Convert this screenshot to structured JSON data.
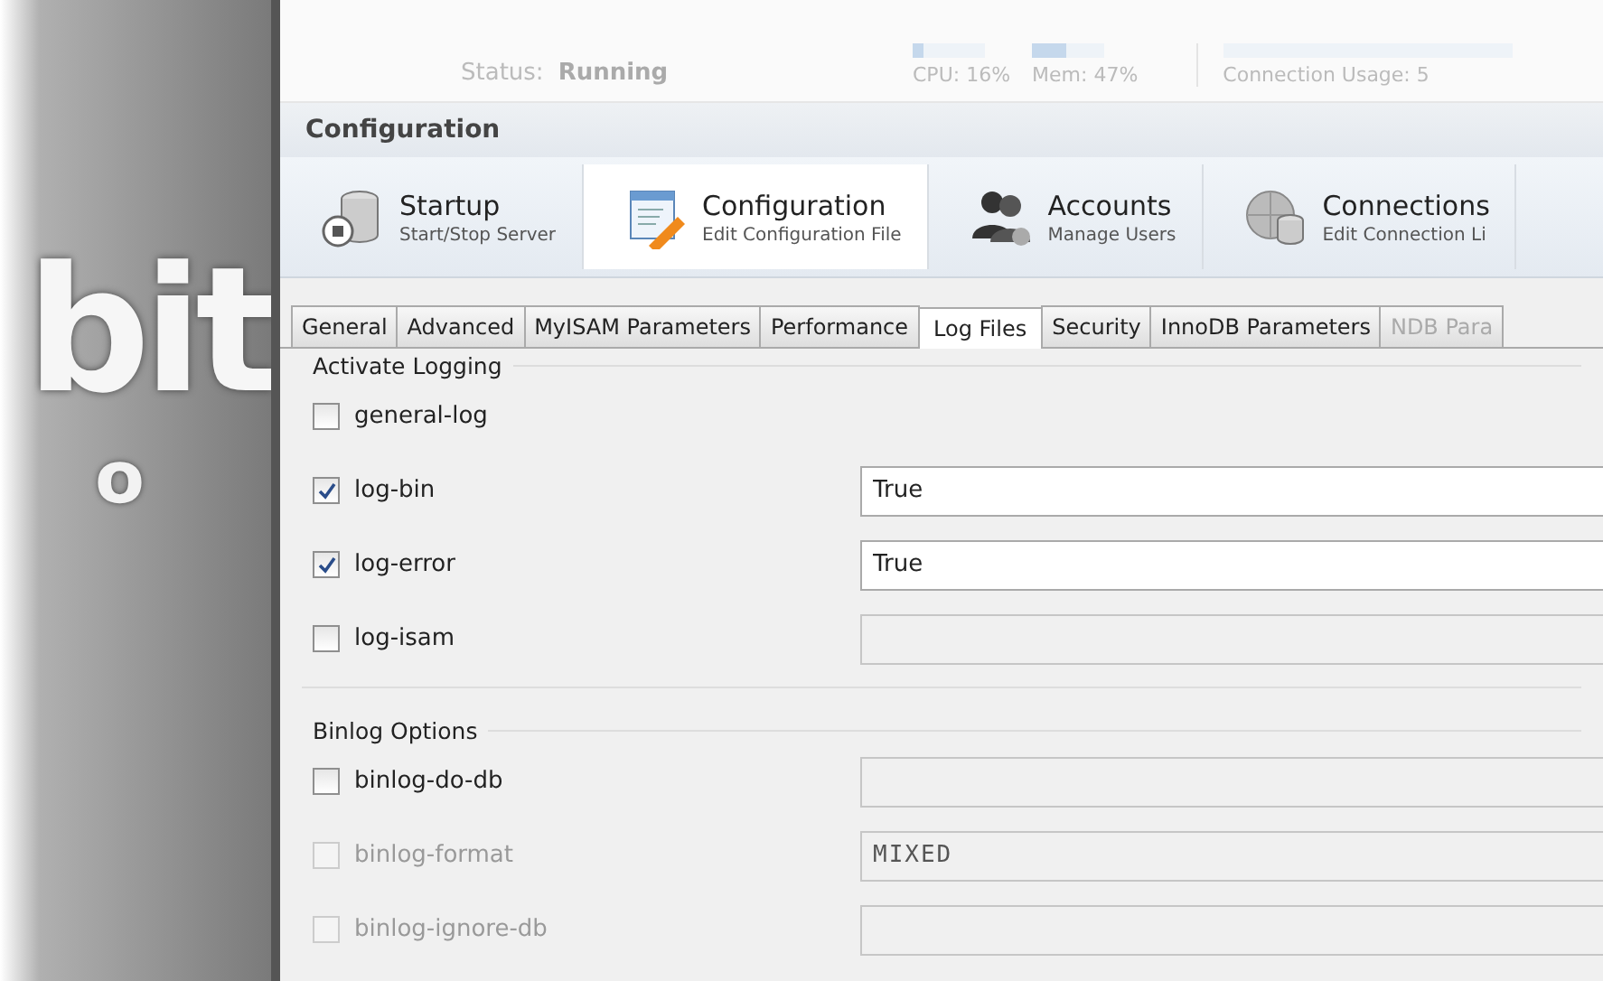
{
  "backdrop": {
    "letters": "bit",
    "lower_letter": "o"
  },
  "status": {
    "label": "Status:",
    "value": "Running",
    "meters": [
      {
        "reading": "CPU: 16%",
        "level": 0.16
      },
      {
        "reading": "Mem: 47%",
        "level": 0.47
      }
    ],
    "connection": "Connection Usage: 5"
  },
  "section_title": "Configuration",
  "toolbar": [
    {
      "kind": "startup",
      "title": "Startup",
      "subtitle": "Start/Stop Server",
      "selected": false
    },
    {
      "kind": "config",
      "title": "Configuration",
      "subtitle": "Edit Configuration File",
      "selected": true
    },
    {
      "kind": "accounts",
      "title": "Accounts",
      "subtitle": "Manage Users",
      "selected": false
    },
    {
      "kind": "connections",
      "title": "Connections",
      "subtitle": "Edit Connection Li",
      "selected": false
    }
  ],
  "tabs": [
    {
      "label": "General",
      "selected": false,
      "disabled": false
    },
    {
      "label": "Advanced",
      "selected": false,
      "disabled": false
    },
    {
      "label": "MyISAM Parameters",
      "selected": false,
      "disabled": false
    },
    {
      "label": "Performance",
      "selected": false,
      "disabled": false
    },
    {
      "label": "Log Files",
      "selected": true,
      "disabled": false
    },
    {
      "label": "Security",
      "selected": false,
      "disabled": false
    },
    {
      "label": "InnoDB Parameters",
      "selected": false,
      "disabled": false
    },
    {
      "label": "NDB Para",
      "selected": false,
      "disabled": true
    }
  ],
  "groups": [
    {
      "title": "Activate Logging",
      "options": [
        {
          "name": "general-log",
          "checked": false,
          "disabled": false
        },
        {
          "name": "log-bin",
          "checked": true,
          "disabled": false,
          "field": {
            "value": "True",
            "disabled": false
          }
        },
        {
          "name": "log-error",
          "checked": true,
          "disabled": false,
          "field": {
            "value": "True",
            "disabled": false
          }
        },
        {
          "name": "log-isam",
          "checked": false,
          "disabled": false,
          "field": {
            "disabled": true
          }
        }
      ]
    },
    {
      "title": "Binlog Options",
      "options": [
        {
          "name": "binlog-do-db",
          "checked": false,
          "disabled": false,
          "field": {
            "disabled": true
          }
        },
        {
          "name": "binlog-format",
          "checked": false,
          "disabled": true,
          "field": {
            "value": "MIXED",
            "disabled": true
          }
        },
        {
          "name": "binlog-ignore-db",
          "checked": false,
          "disabled": true,
          "field": {
            "disabled": true
          }
        }
      ]
    }
  ]
}
